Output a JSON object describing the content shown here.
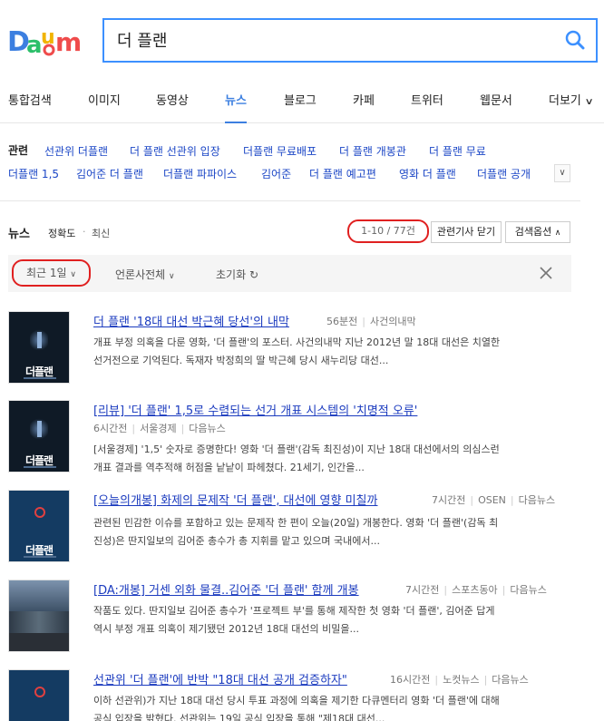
{
  "header": {
    "logo_text": "Daum",
    "search_value": "더 플랜",
    "colors": {
      "accent": "#3c90ff",
      "logo_d": "#3c7fe0",
      "logo_a": "#2cbf6a",
      "logo_u": "#f1b400",
      "logo_m": "#ef4b4b",
      "logo_o": "#ef4b4b"
    }
  },
  "tabs": [
    "통합검색",
    "이미지",
    "동영상",
    "뉴스",
    "블로그",
    "카페",
    "트위터",
    "웹문서",
    "더보기"
  ],
  "related": {
    "label": "관련",
    "links": [
      "선관위 더플랜",
      "더 플랜 선관위 입장",
      "더플랜 무료배포",
      "더 플랜 개봉관",
      "더 플랜 무료",
      "더플랜 1,5",
      "김어준 더 플랜",
      "더플랜 파파이스",
      "김어준",
      "더 플랜 예고편",
      "영화 더 플랜",
      "더플랜 공개"
    ]
  },
  "news_bar": {
    "label": "뉴스",
    "sort_accuracy": "정확도",
    "sort_latest": "최신",
    "count": "1-10 / 77건",
    "close_related": "관련기사 닫기",
    "search_options": "검색옵션"
  },
  "filter": {
    "recent": "최근 1일",
    "press": "언론사전체",
    "reset": "초기화"
  },
  "articles": [
    {
      "title": "더 플랜 '18대 대선 박근혜 당선'의 내막",
      "time": "56분전",
      "source": "사건의내막",
      "source2": "",
      "desc1": "개표 부정 의혹을 다룬 영화, '더 플랜'의 포스터. 사건의내막 지난 2012년 말 18대 대선은 치열한",
      "desc2": "선거전으로 기억된다. 독재자 박정희의 딸 박근혜 당시 새누리당 대선..."
    },
    {
      "title": "[리뷰] '더 플랜' 1,5로 수렴되는 선거 개표 시스템의 '치명적 오류'",
      "time": "6시간전",
      "source": "서울경제",
      "source2": "다음뉴스",
      "desc1": "[서울경제] '1,5' 숫자로 증명한다! 영화 '더 플랜'(감독 최진성)이 지난 18대 대선에서의 의심스런",
      "desc2": "개표 결과를 역추적해 허점을 낱낱이 파헤쳤다. 21세기, 인간을..."
    },
    {
      "title": "[오늘의개봉] 화제의 문제작 '더 플랜', 대선에 영향 미칠까",
      "time": "7시간전",
      "source": "OSEN",
      "source2": "다음뉴스",
      "desc1": "관련된 민감한 이슈를 포함하고 있는 문제작 한 편이 오늘(20일) 개봉한다. 영화 '더 플랜'(감독 최",
      "desc2": "진성)은 딴지일보의 김어준 총수가 총 지휘를 맡고 있으며 국내에서..."
    },
    {
      "title": "[DA:개봉] 거센 외화 물결..김어준 '더 플랜' 함께 개봉",
      "time": "7시간전",
      "source": "스포츠동아",
      "source2": "다음뉴스",
      "desc1": "작품도 있다. 딴지일보 김어준 총수가 '프로젝트 부'를 통해 제작한 첫 영화 '더 플랜', 김어준 답게",
      "desc2": "역시 부정 개표 의혹이 제기됐던 2012년 18대 대선의 비밀을..."
    },
    {
      "title": "선관위 '더 플랜'에 반박 \"18대 대선 공개 검증하자\"",
      "time": "16시간전",
      "source": "노컷뉴스",
      "source2": "다음뉴스",
      "desc1": "이하 선관위)가 지난 18대 대선 당시 투표 과정에 의혹을 제기한 다큐멘터리 영화 '더 플랜'에 대해",
      "desc2": "공식 입장을 밝혔다. 선관위는 19일 공식 입장을 통해 \"제18대 대선..."
    }
  ],
  "thumb_title": "더플랜"
}
